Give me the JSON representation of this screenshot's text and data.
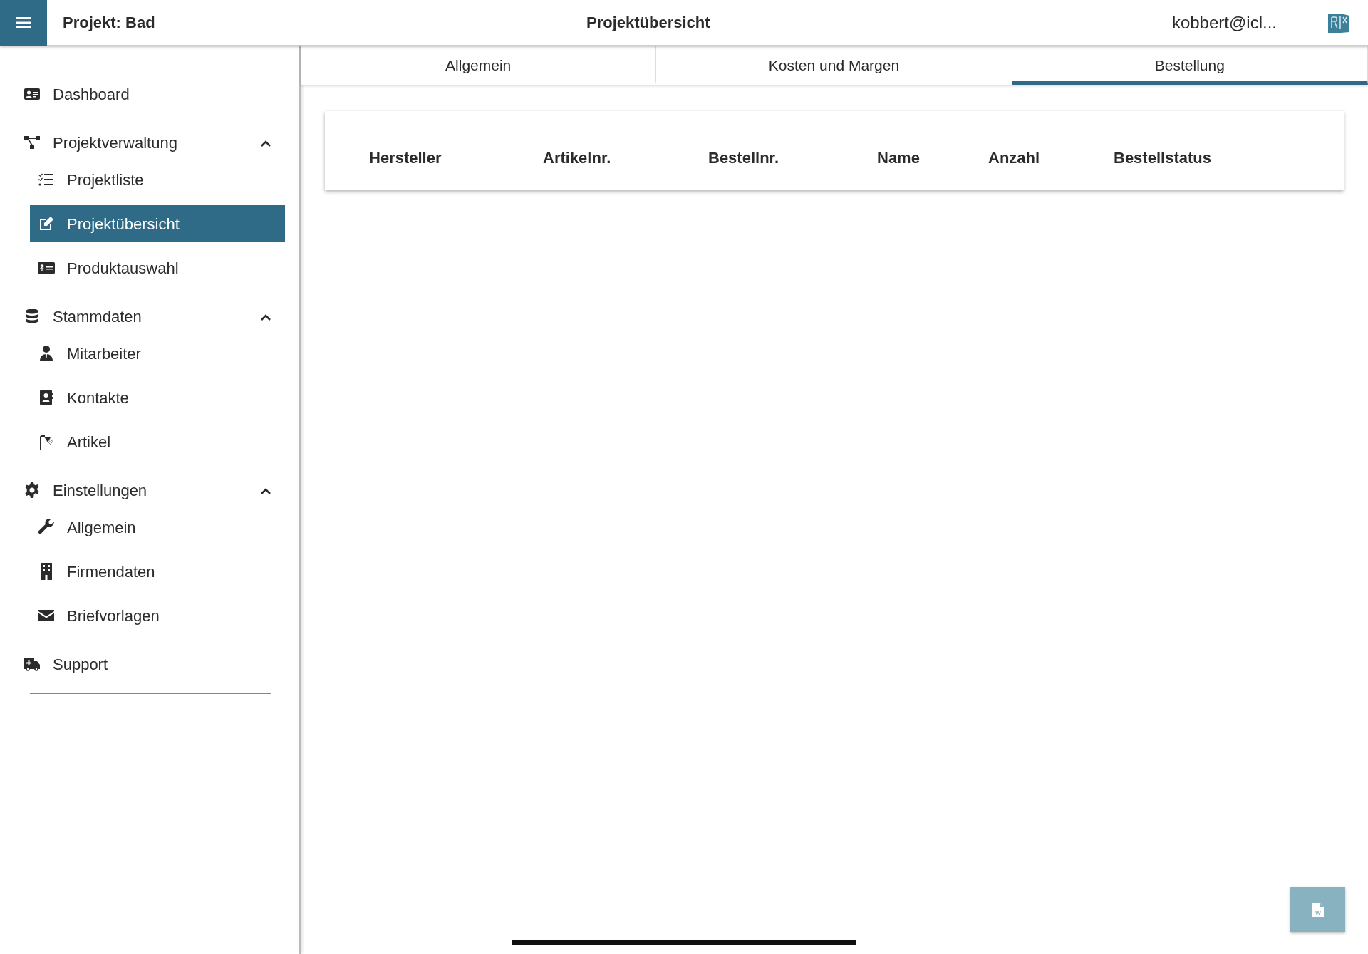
{
  "topbar": {
    "project_title": "Projekt: Bad",
    "page_title": "Projektübersicht",
    "user": "kobbert@icl..."
  },
  "sidebar": {
    "items": [
      {
        "kind": "link",
        "label": "Dashboard",
        "selected": false
      },
      {
        "kind": "group",
        "label": "Projektverwaltung",
        "expanded": true,
        "children": [
          {
            "label": "Projektliste",
            "selected": false
          },
          {
            "label": "Projektübersicht",
            "selected": true
          },
          {
            "label": "Produktauswahl",
            "selected": false
          }
        ]
      },
      {
        "kind": "group",
        "label": "Stammdaten",
        "expanded": true,
        "children": [
          {
            "label": "Mitarbeiter",
            "selected": false
          },
          {
            "label": "Kontakte",
            "selected": false
          },
          {
            "label": "Artikel",
            "selected": false
          }
        ]
      },
      {
        "kind": "group",
        "label": "Einstellungen",
        "expanded": true,
        "children": [
          {
            "label": "Allgemein",
            "selected": false
          },
          {
            "label": "Firmendaten",
            "selected": false
          },
          {
            "label": "Briefvorlagen",
            "selected": false
          }
        ]
      },
      {
        "kind": "link",
        "label": "Support",
        "selected": false
      }
    ]
  },
  "tabs": [
    {
      "label": "Allgemein",
      "selected": false
    },
    {
      "label": "Kosten und Margen",
      "selected": false
    },
    {
      "label": "Bestellung",
      "selected": true
    }
  ],
  "table": {
    "columns": [
      "Hersteller",
      "Artikelnr.",
      "Bestellnr.",
      "Name",
      "Anzahl",
      "Bestellstatus"
    ]
  },
  "export_button": {
    "icon_letter": "W"
  }
}
